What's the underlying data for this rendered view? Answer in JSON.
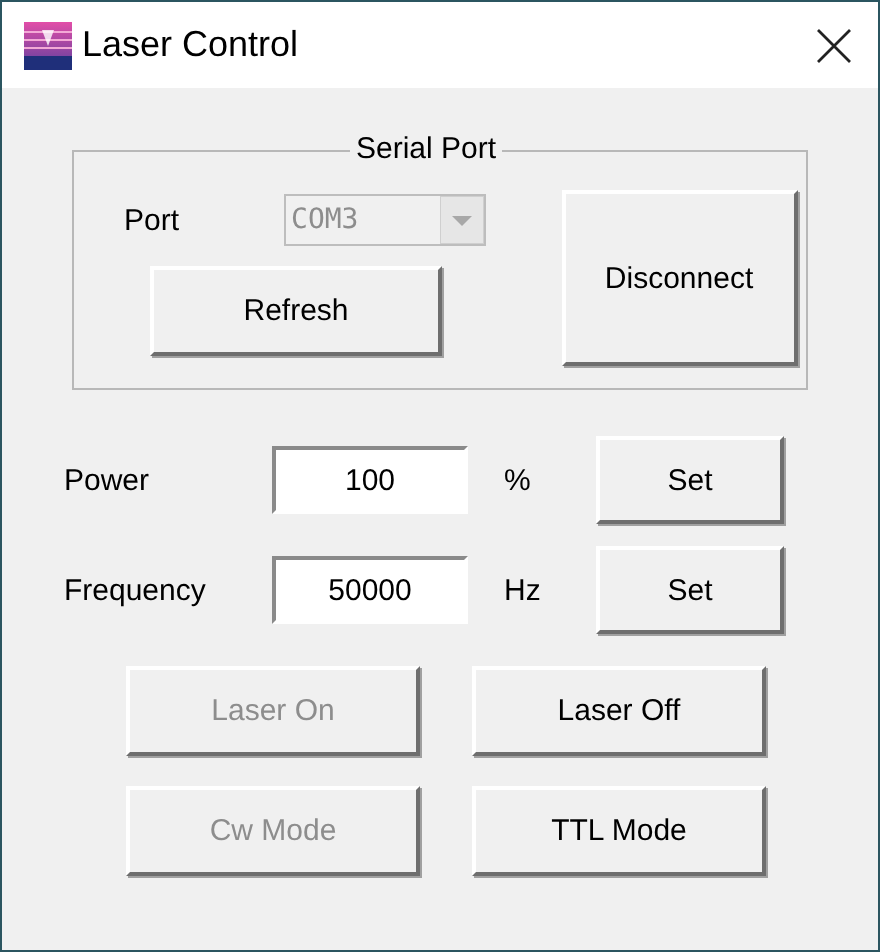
{
  "window": {
    "title": "Laser Control"
  },
  "serial_port": {
    "title": "Serial Port",
    "port_label": "Port",
    "port": {
      "value": "COM3",
      "disabled": true
    },
    "buttons": [
      {
        "kind": "refresh",
        "label": "Refresh",
        "disabled": false
      },
      {
        "kind": "connect",
        "label": "Disconnect",
        "disabled": false
      }
    ]
  },
  "params": [
    {
      "label": "Power",
      "value": "100",
      "unit": "%",
      "button": "Set"
    },
    {
      "label": "Frequency",
      "value": "50000",
      "unit": "Hz",
      "button": "Set"
    }
  ],
  "actions": [
    {
      "label": "Laser On",
      "disabled": true
    },
    {
      "label": "Laser Off",
      "disabled": false
    },
    {
      "label": "Cw Mode",
      "disabled": true
    },
    {
      "label": "TTL Mode",
      "disabled": false
    }
  ]
}
